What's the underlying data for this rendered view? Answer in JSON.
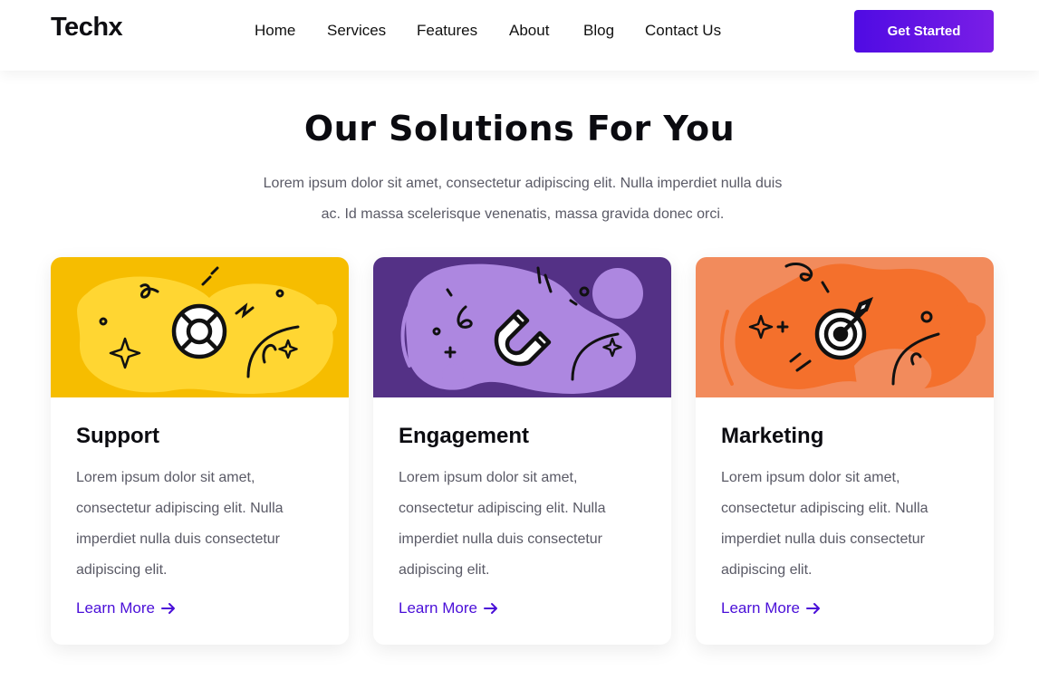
{
  "brand": {
    "name": "Techx"
  },
  "nav": {
    "links": [
      "Home",
      "Services",
      "Features",
      "About",
      "Blog",
      "Contact Us"
    ],
    "cta_label": "Get Started"
  },
  "hero": {
    "title": "Our Solutions For You",
    "description": "Lorem ipsum dolor sit amet, consectetur adipiscing elit. Nulla imperdiet nulla duis ac. Id massa scelerisque venenatis, massa gravida donec orci."
  },
  "colors": {
    "accent": "#5b10e6",
    "support_bg": "#f6bd00",
    "engagement_bg": "#543186",
    "marketing_bg": "#f28b5c"
  },
  "cards": [
    {
      "title": "Support",
      "text": "Lorem ipsum dolor sit amet, consectetur adipiscing elit. Nulla imperdiet nulla duis consectetur adipiscing elit.",
      "link_label": "Learn More",
      "icon": "lifebuoy-icon"
    },
    {
      "title": "Engagement",
      "text": "Lorem ipsum dolor sit amet, consectetur adipiscing elit. Nulla imperdiet nulla duis consectetur adipiscing elit.",
      "link_label": "Learn More",
      "icon": "magnet-icon"
    },
    {
      "title": "Marketing",
      "text": "Lorem ipsum dolor sit amet, consectetur adipiscing elit. Nulla imperdiet nulla duis consectetur adipiscing elit.",
      "link_label": "Learn More",
      "icon": "target-icon"
    }
  ]
}
